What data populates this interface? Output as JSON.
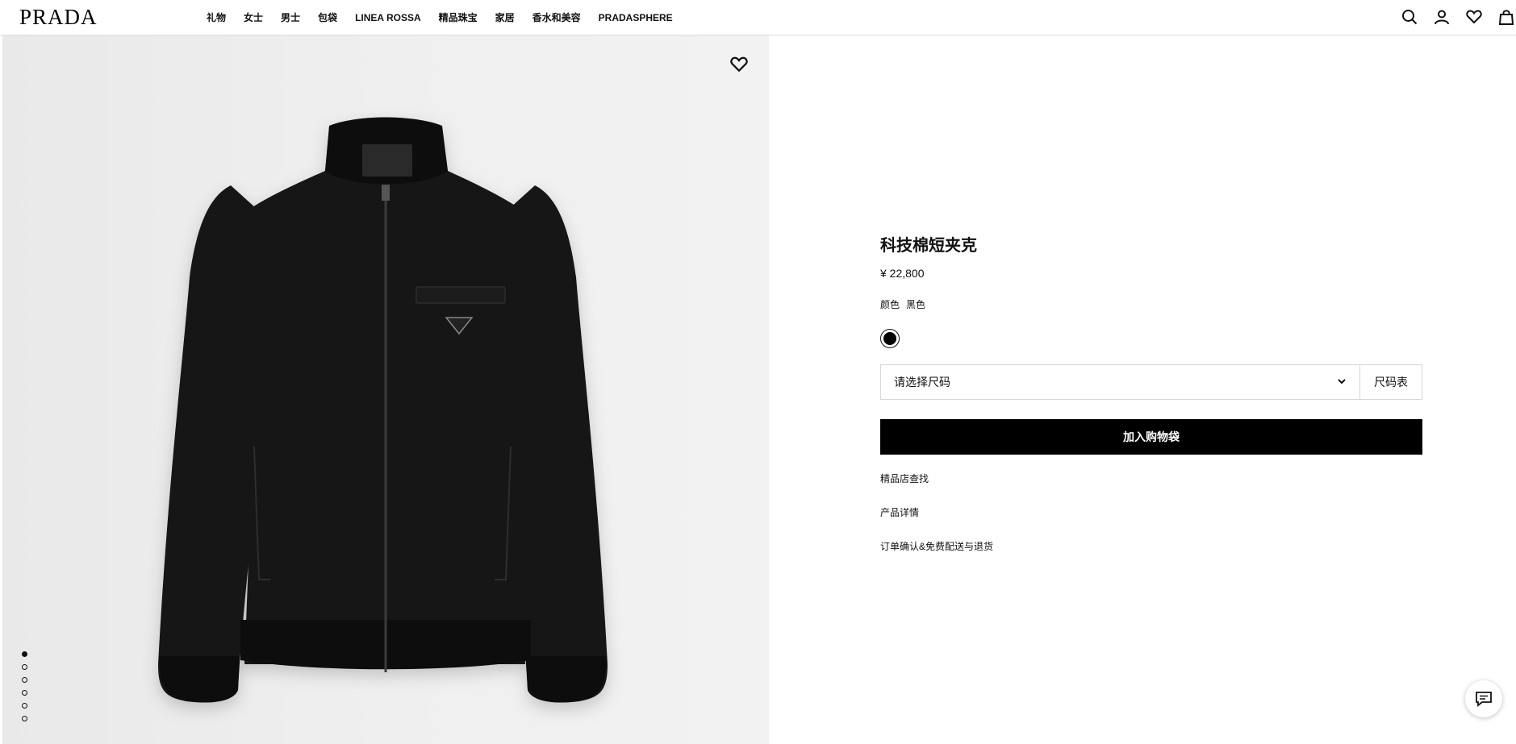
{
  "brand": {
    "logo": "PRADA"
  },
  "nav": {
    "items": [
      {
        "label": "礼物"
      },
      {
        "label": "女士"
      },
      {
        "label": "男士"
      },
      {
        "label": "包袋"
      },
      {
        "label": "LINEA ROSSA"
      },
      {
        "label": "精品珠宝"
      },
      {
        "label": "家居"
      },
      {
        "label": "香水和美容"
      },
      {
        "label": "PRADASPHERE"
      }
    ]
  },
  "header_icons": [
    "search-icon",
    "account-icon",
    "wishlist-icon",
    "bag-icon"
  ],
  "gallery": {
    "image": "black-tech-cotton-jacket",
    "dots_total": 6,
    "active_dot": 1
  },
  "product": {
    "name": "科技棉短夹克",
    "price": "¥ 22,800",
    "color_label": "颜色",
    "color_value": "黑色",
    "swatch_color": "#000000",
    "size_placeholder": "请选择尺码",
    "size_guide": "尺码表",
    "add_to_bag": "加入购物袋",
    "links": {
      "store_locator": "精品店查找",
      "details": "产品详情",
      "shipping": "订单确认&免费配送与退货"
    }
  },
  "colors": {
    "button": "#000000",
    "gallery_bg": "#efefef",
    "border": "#d6d6d6"
  }
}
